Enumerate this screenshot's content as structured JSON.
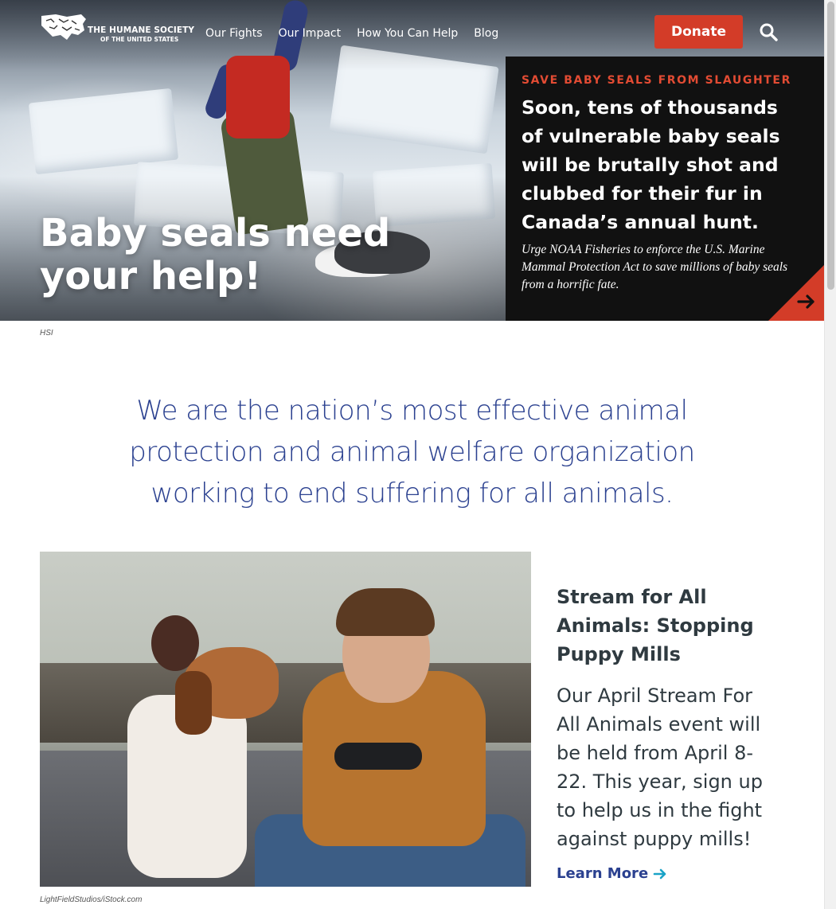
{
  "header": {
    "logo_line1": "THE HUMANE SOCIETY",
    "logo_line2": "OF THE UNITED STATES",
    "nav": [
      {
        "label": "Our Fights"
      },
      {
        "label": "Our Impact"
      },
      {
        "label": "How You Can Help"
      },
      {
        "label": "Blog"
      }
    ],
    "donate_label": "Donate",
    "search_icon": "search-icon"
  },
  "hero": {
    "title": "Baby seals need your help!",
    "caption": "HSI"
  },
  "callout": {
    "eyebrow": "SAVE BABY SEALS FROM SLAUGHTER",
    "headline": "Soon, tens of thousands of vulnerable baby seals will be brutally shot and clubbed for their fur in Canada’s annual hunt.",
    "body": "Urge NOAA Fisheries to enforce the U.S. Marine Mammal Protection Act to save millions of baby seals from a horrific fate.",
    "arrow_icon": "arrow-right-icon"
  },
  "mission": {
    "text": "We are the nation’s most effective animal protection and animal welfare organization working to end suffering for all animals."
  },
  "feature": {
    "image_caption": "LightFieldStudios/iStock.com",
    "title": "Stream for All Animals: Stopping Puppy Mills",
    "body": "Our April Stream For All Animals event will be held from April 8-22. This year, sign up to help us in the fight against puppy mills!",
    "link_label": "Learn More",
    "link_icon": "arrow-right-icon"
  },
  "colors": {
    "brand_red": "#d33c28",
    "eyebrow_red": "#e24b33",
    "mission_blue": "#2b4190",
    "callout_bg": "#111111"
  }
}
